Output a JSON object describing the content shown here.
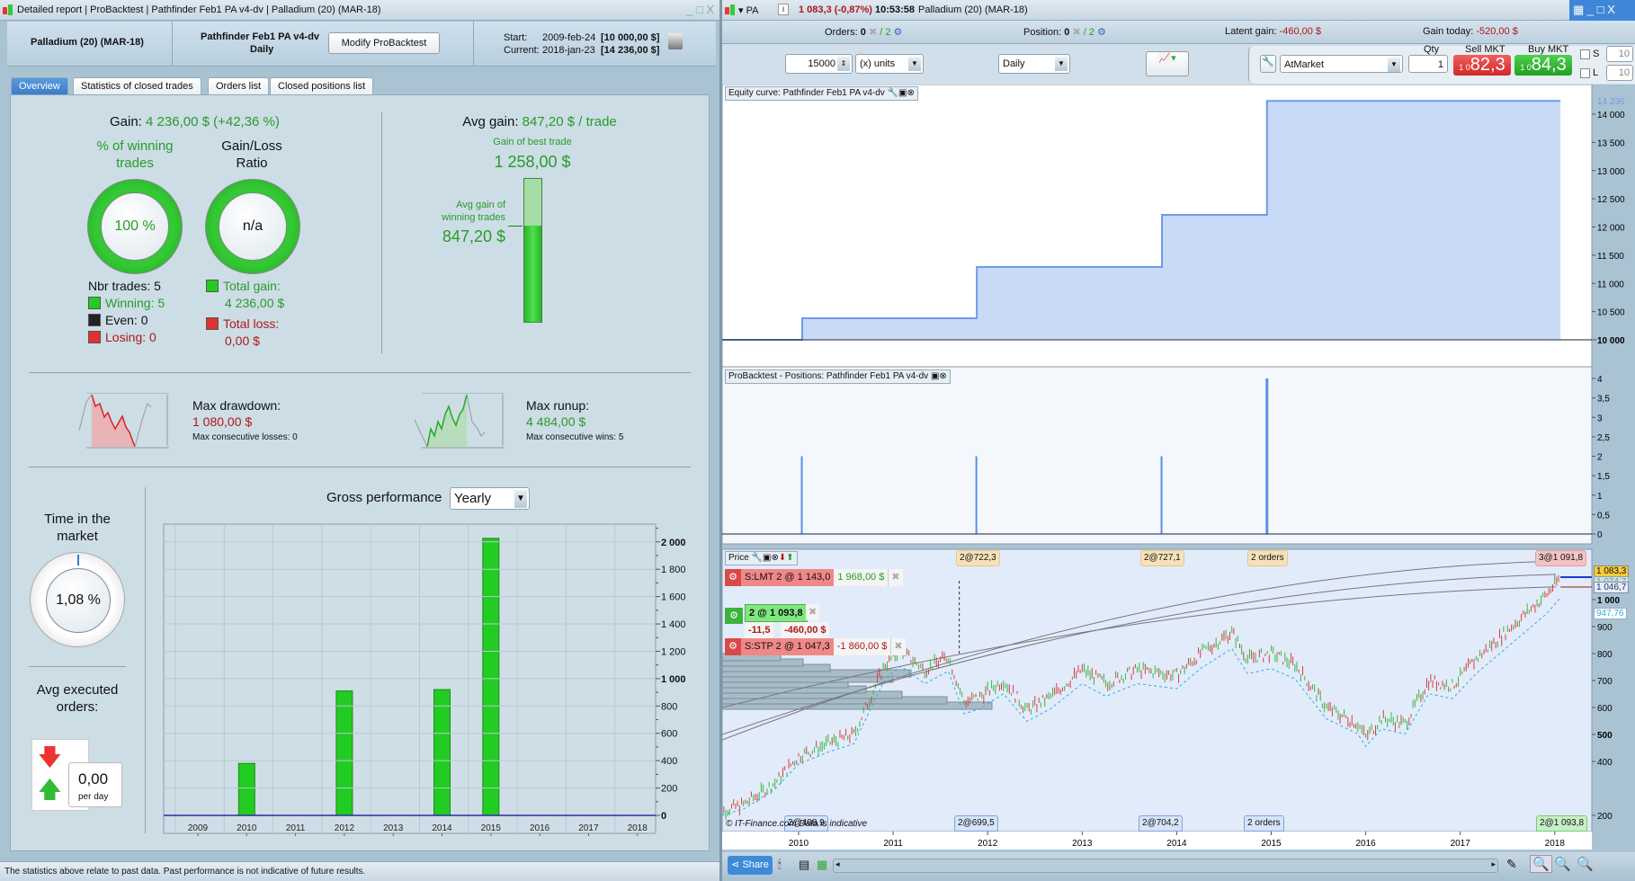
{
  "left": {
    "title": "Detailed report | ProBacktest | Pathfinder Feb1 PA v4-dv | Palladium (20) (MAR-18)",
    "instrument": "Palladium (20) (MAR-18)",
    "strategy": "Pathfinder Feb1 PA v4-dv",
    "timeframe": "Daily",
    "modify_label": "Modify ProBacktest",
    "start_label": "Start:",
    "start_date": "2009-feb-24",
    "start_value": "[10 000,00 $]",
    "current_label": "Current:",
    "current_date": "2018-jan-23",
    "current_value": "[14 236,00 $]",
    "tabs": [
      {
        "label": "Overview",
        "active": true
      },
      {
        "label": "Statistics of closed trades"
      },
      {
        "label": "Orders list"
      },
      {
        "label": "Closed positions list"
      }
    ],
    "gain_label": "Gain:",
    "gain_value": "4 236,00 $ (+42,36 %)",
    "winning_pct_label": "% of winning trades",
    "winning_pct": "100 %",
    "gl_ratio_label": "Gain/Loss Ratio",
    "gl_ratio": "n/a",
    "nbr_trades": "Nbr trades: 5",
    "winning": "Winning: 5",
    "even": "Even: 0",
    "losing": "Losing: 0",
    "total_gain_label": "Total gain:",
    "total_gain": "4 236,00 $",
    "total_loss_label": "Total loss:",
    "total_loss": "0,00 $",
    "avg_gain_label": "Avg gain:",
    "avg_gain": "847,20 $ / trade",
    "best_trade_label": "Gain of best trade",
    "best_trade": "1 258,00 $",
    "avg_win_label": "Avg gain of winning trades",
    "avg_win": "847,20 $",
    "avg_win_fraction": 0.673,
    "max_dd_label": "Max drawdown:",
    "max_dd": "1 080,00 $",
    "max_cons_losses": "Max consecutive losses: 0",
    "max_ru_label": "Max runup:",
    "max_ru": "4 484,00 $",
    "max_cons_wins": "Max consecutive wins: 5",
    "time_market_label": "Time in the market",
    "time_market": "1,08 %",
    "time_market_fraction": 0.0108,
    "avg_orders_label": "Avg executed orders:",
    "avg_orders": "0,00",
    "per_day": "per day",
    "gross_label": "Gross performance",
    "gross_period": "Yearly",
    "footer": "The statistics above relate to past data. Past performance is not indicative of future results."
  },
  "right": {
    "ticker": "PA",
    "price_change": "1 083,3 (-0,87%)",
    "time": "10:53:58",
    "instrument": "Palladium (20) (MAR-18)",
    "orders_label": "Orders:",
    "orders_value": "0",
    "orders_auto": "/ 2",
    "position_label": "Position:",
    "position_value": "0",
    "position_auto": "/ 2",
    "latent_label": "Latent gain:",
    "latent_value": "-460,00 $",
    "today_label": "Gain today:",
    "today_value": "-520,00 $",
    "qty_units": "15000",
    "units": "(x) units",
    "period": "Daily",
    "order_type": "AtMarket",
    "qty_label": "Qty",
    "qty": "1",
    "sell_label": "Sell MKT",
    "sell_price": "82,3",
    "buy_label": "Buy MKT",
    "buy_price": "84,3",
    "price_prefix": "1 0",
    "s_label": "S",
    "s_value": "10",
    "l_label": "L",
    "l_value": "10",
    "equity_title": "Equity curve: Pathfinder Feb1 PA v4-dv",
    "positions_title": "ProBacktest - Positions: Pathfinder Feb1 PA v4-dv",
    "price_title": "Price",
    "slmt": {
      "label": "S:LMT  2 @ 1 143,0",
      "value": "1 968,00 $"
    },
    "pos": {
      "label": "2 @ 1 093,8",
      "points": "-11,5",
      "value": "-460,00 $"
    },
    "sstp": {
      "label": "S:STP  2 @ 1 047,3",
      "value": "-1 860,00 $"
    },
    "top_tags": [
      "2@722,3",
      "2@727,1",
      "2 orders",
      "3@1 091,8"
    ],
    "bottom_tags": [
      "2@408,9",
      "2@699,5",
      "2@704,2",
      "2 orders",
      "2@1 093,8"
    ],
    "price_labels": {
      "last": "1 083,3",
      "second": "1 074,7",
      "stop": "1 046,7",
      "ma": "947,76"
    },
    "copyright": "© IT-Finance.com  Data is indicative",
    "share_label": "Share"
  },
  "chart_data": [
    {
      "type": "bar",
      "title": "Gross performance",
      "categories": [
        "2009",
        "2010",
        "2011",
        "2012",
        "2013",
        "2014",
        "2015",
        "2016",
        "2017",
        "2018"
      ],
      "values": [
        0,
        380,
        0,
        910,
        0,
        920,
        2026,
        0,
        0,
        0
      ],
      "ylim": [
        0,
        2130
      ],
      "yticks": [
        0,
        200,
        400,
        600,
        800,
        1000,
        1200,
        1400,
        1600,
        1800,
        2000
      ],
      "grid": true,
      "color": "#22cc22"
    },
    {
      "type": "line",
      "title": "Equity curve: Pathfinder Feb1 PA v4-dv",
      "step": true,
      "points": [
        [
          "2009-02-24",
          10000
        ],
        [
          "2010-01-15",
          10382
        ],
        [
          "2011-11-20",
          11290
        ],
        [
          "2013-11-05",
          12215
        ],
        [
          "2014-12-15",
          14236
        ],
        [
          "2018-01-23",
          14236
        ]
      ],
      "ylim": [
        9500,
        14300
      ],
      "yticks": [
        10000,
        10500,
        11000,
        11500,
        12000,
        12500,
        13000,
        13500,
        14000
      ],
      "last_label": "14 236",
      "color": "#6f9ae8"
    },
    {
      "type": "bar",
      "title": "ProBacktest - Positions: Pathfinder Feb1 PA v4-dv",
      "points": [
        [
          "2010-01-15",
          2
        ],
        [
          "2011-11-20",
          2
        ],
        [
          "2013-11-05",
          2
        ],
        [
          "2014-12-15",
          4
        ]
      ],
      "ylim": [
        0,
        4
      ],
      "yticks": [
        "0",
        "0,5",
        "1",
        "1,5",
        "2",
        "2,5",
        "3",
        "3,5",
        "4"
      ],
      "color": "#5b8fe8"
    },
    {
      "type": "line",
      "title": "Price",
      "xticks": [
        "2010",
        "2011",
        "2012",
        "2013",
        "2014",
        "2015",
        "2016",
        "2017",
        "2018"
      ],
      "yticks": [
        200,
        400,
        500,
        600,
        700,
        800,
        900,
        1000
      ],
      "points": [
        [
          "2009-02",
          205
        ],
        [
          "2009-06",
          240
        ],
        [
          "2009-10",
          320
        ],
        [
          "2010-01",
          420
        ],
        [
          "2010-05",
          470
        ],
        [
          "2010-08",
          500
        ],
        [
          "2010-12",
          760
        ],
        [
          "2011-02",
          810
        ],
        [
          "2011-05",
          740
        ],
        [
          "2011-08",
          790
        ],
        [
          "2011-10",
          620
        ],
        [
          "2011-12",
          640
        ],
        [
          "2012-03",
          700
        ],
        [
          "2012-06",
          590
        ],
        [
          "2012-09",
          640
        ],
        [
          "2013-01",
          740
        ],
        [
          "2013-04",
          690
        ],
        [
          "2013-08",
          740
        ],
        [
          "2014-01",
          720
        ],
        [
          "2014-04",
          800
        ],
        [
          "2014-08",
          880
        ],
        [
          "2014-10",
          780
        ],
        [
          "2015-01",
          800
        ],
        [
          "2015-04",
          760
        ],
        [
          "2015-08",
          600
        ],
        [
          "2015-12",
          540
        ],
        [
          "2016-01",
          490
        ],
        [
          "2016-03",
          560
        ],
        [
          "2016-06",
          540
        ],
        [
          "2016-09",
          700
        ],
        [
          "2016-12",
          680
        ],
        [
          "2017-03",
          780
        ],
        [
          "2017-06",
          860
        ],
        [
          "2017-09",
          940
        ],
        [
          "2017-12",
          1020
        ],
        [
          "2018-01-23",
          1083
        ]
      ],
      "colors": {
        "up": "#3cb43c",
        "down": "#d04040"
      }
    }
  ]
}
